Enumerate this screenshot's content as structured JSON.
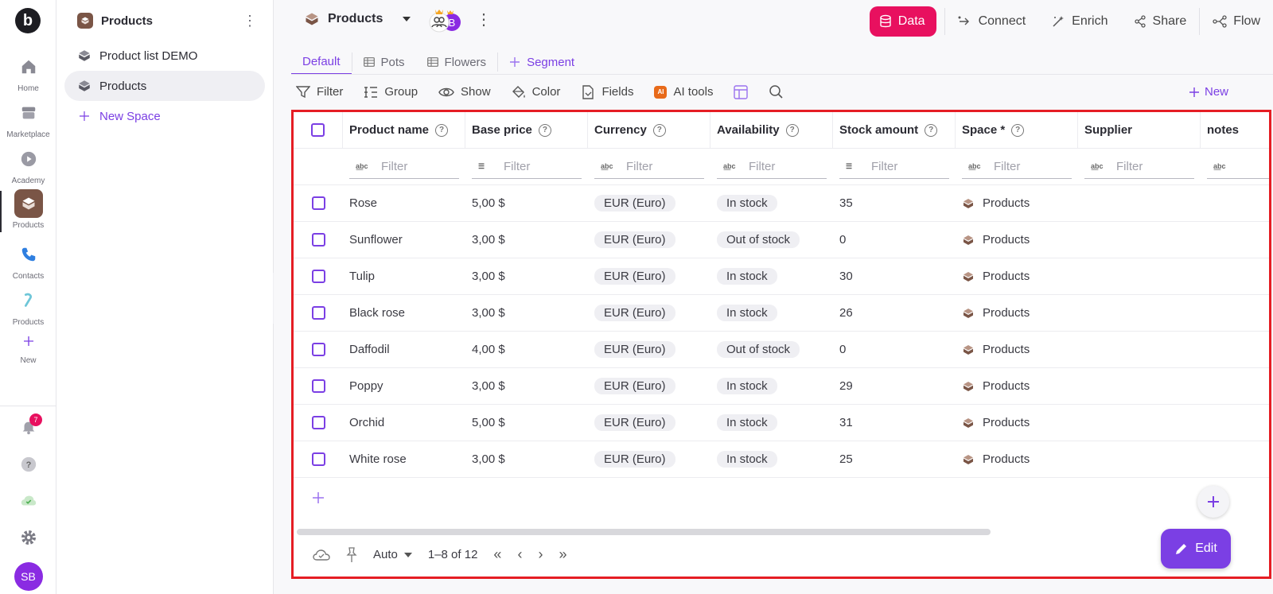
{
  "rail": {
    "logo": "b",
    "items": [
      {
        "label": "Home"
      },
      {
        "label": "Marketplace"
      },
      {
        "label": "Academy"
      },
      {
        "label": "Products"
      },
      {
        "label": "Contacts"
      },
      {
        "label": "Products"
      },
      {
        "label": "New"
      }
    ],
    "notification_count": "7",
    "user_initials": "SB"
  },
  "spaces": {
    "title": "Products",
    "items": [
      {
        "label": "Product list DEMO"
      },
      {
        "label": "Products"
      }
    ],
    "new_label": "New Space"
  },
  "topbar": {
    "title": "Products",
    "avatar_initial": "B",
    "actions": {
      "data": "Data",
      "connect": "Connect",
      "enrich": "Enrich",
      "share": "Share",
      "flow": "Flow"
    }
  },
  "tabs": [
    {
      "label": "Default"
    },
    {
      "label": "Pots"
    },
    {
      "label": "Flowers"
    },
    {
      "label": "Segment"
    }
  ],
  "toolbar": {
    "filter": "Filter",
    "group": "Group",
    "show": "Show",
    "color": "Color",
    "fields": "Fields",
    "ai_tools": "AI tools",
    "ai_badge": "AI",
    "new": "New"
  },
  "table": {
    "columns": [
      "Product name",
      "Base price",
      "Currency",
      "Availability",
      "Stock amount",
      "Space *",
      "Supplier",
      "notes"
    ],
    "filter_placeholder": "Filter",
    "rows": [
      {
        "name": "Rose",
        "price": "5,00 $",
        "currency": "EUR (Euro)",
        "availability": "In stock",
        "stock": "35",
        "space": "Products"
      },
      {
        "name": "Sunflower",
        "price": "3,00 $",
        "currency": "EUR (Euro)",
        "availability": "Out of stock",
        "stock": "0",
        "space": "Products"
      },
      {
        "name": "Tulip",
        "price": "3,00 $",
        "currency": "EUR (Euro)",
        "availability": "In stock",
        "stock": "30",
        "space": "Products"
      },
      {
        "name": "Black rose",
        "price": "3,00 $",
        "currency": "EUR (Euro)",
        "availability": "In stock",
        "stock": "26",
        "space": "Products"
      },
      {
        "name": "Daffodil",
        "price": "4,00 $",
        "currency": "EUR (Euro)",
        "availability": "Out of stock",
        "stock": "0",
        "space": "Products"
      },
      {
        "name": "Poppy",
        "price": "3,00 $",
        "currency": "EUR (Euro)",
        "availability": "In stock",
        "stock": "29",
        "space": "Products"
      },
      {
        "name": "Orchid",
        "price": "5,00 $",
        "currency": "EUR (Euro)",
        "availability": "In stock",
        "stock": "31",
        "space": "Products"
      },
      {
        "name": "White rose",
        "price": "3,00 $",
        "currency": "EUR (Euro)",
        "availability": "In stock",
        "stock": "25",
        "space": "Products"
      }
    ]
  },
  "pager": {
    "mode": "Auto",
    "range": "1–8 of 12"
  },
  "edit_label": "Edit",
  "colors": {
    "accent": "#7b3fe4",
    "data_button": "#e8105f",
    "space_brown": "#7a5546",
    "highlight_border": "#e51d24"
  }
}
